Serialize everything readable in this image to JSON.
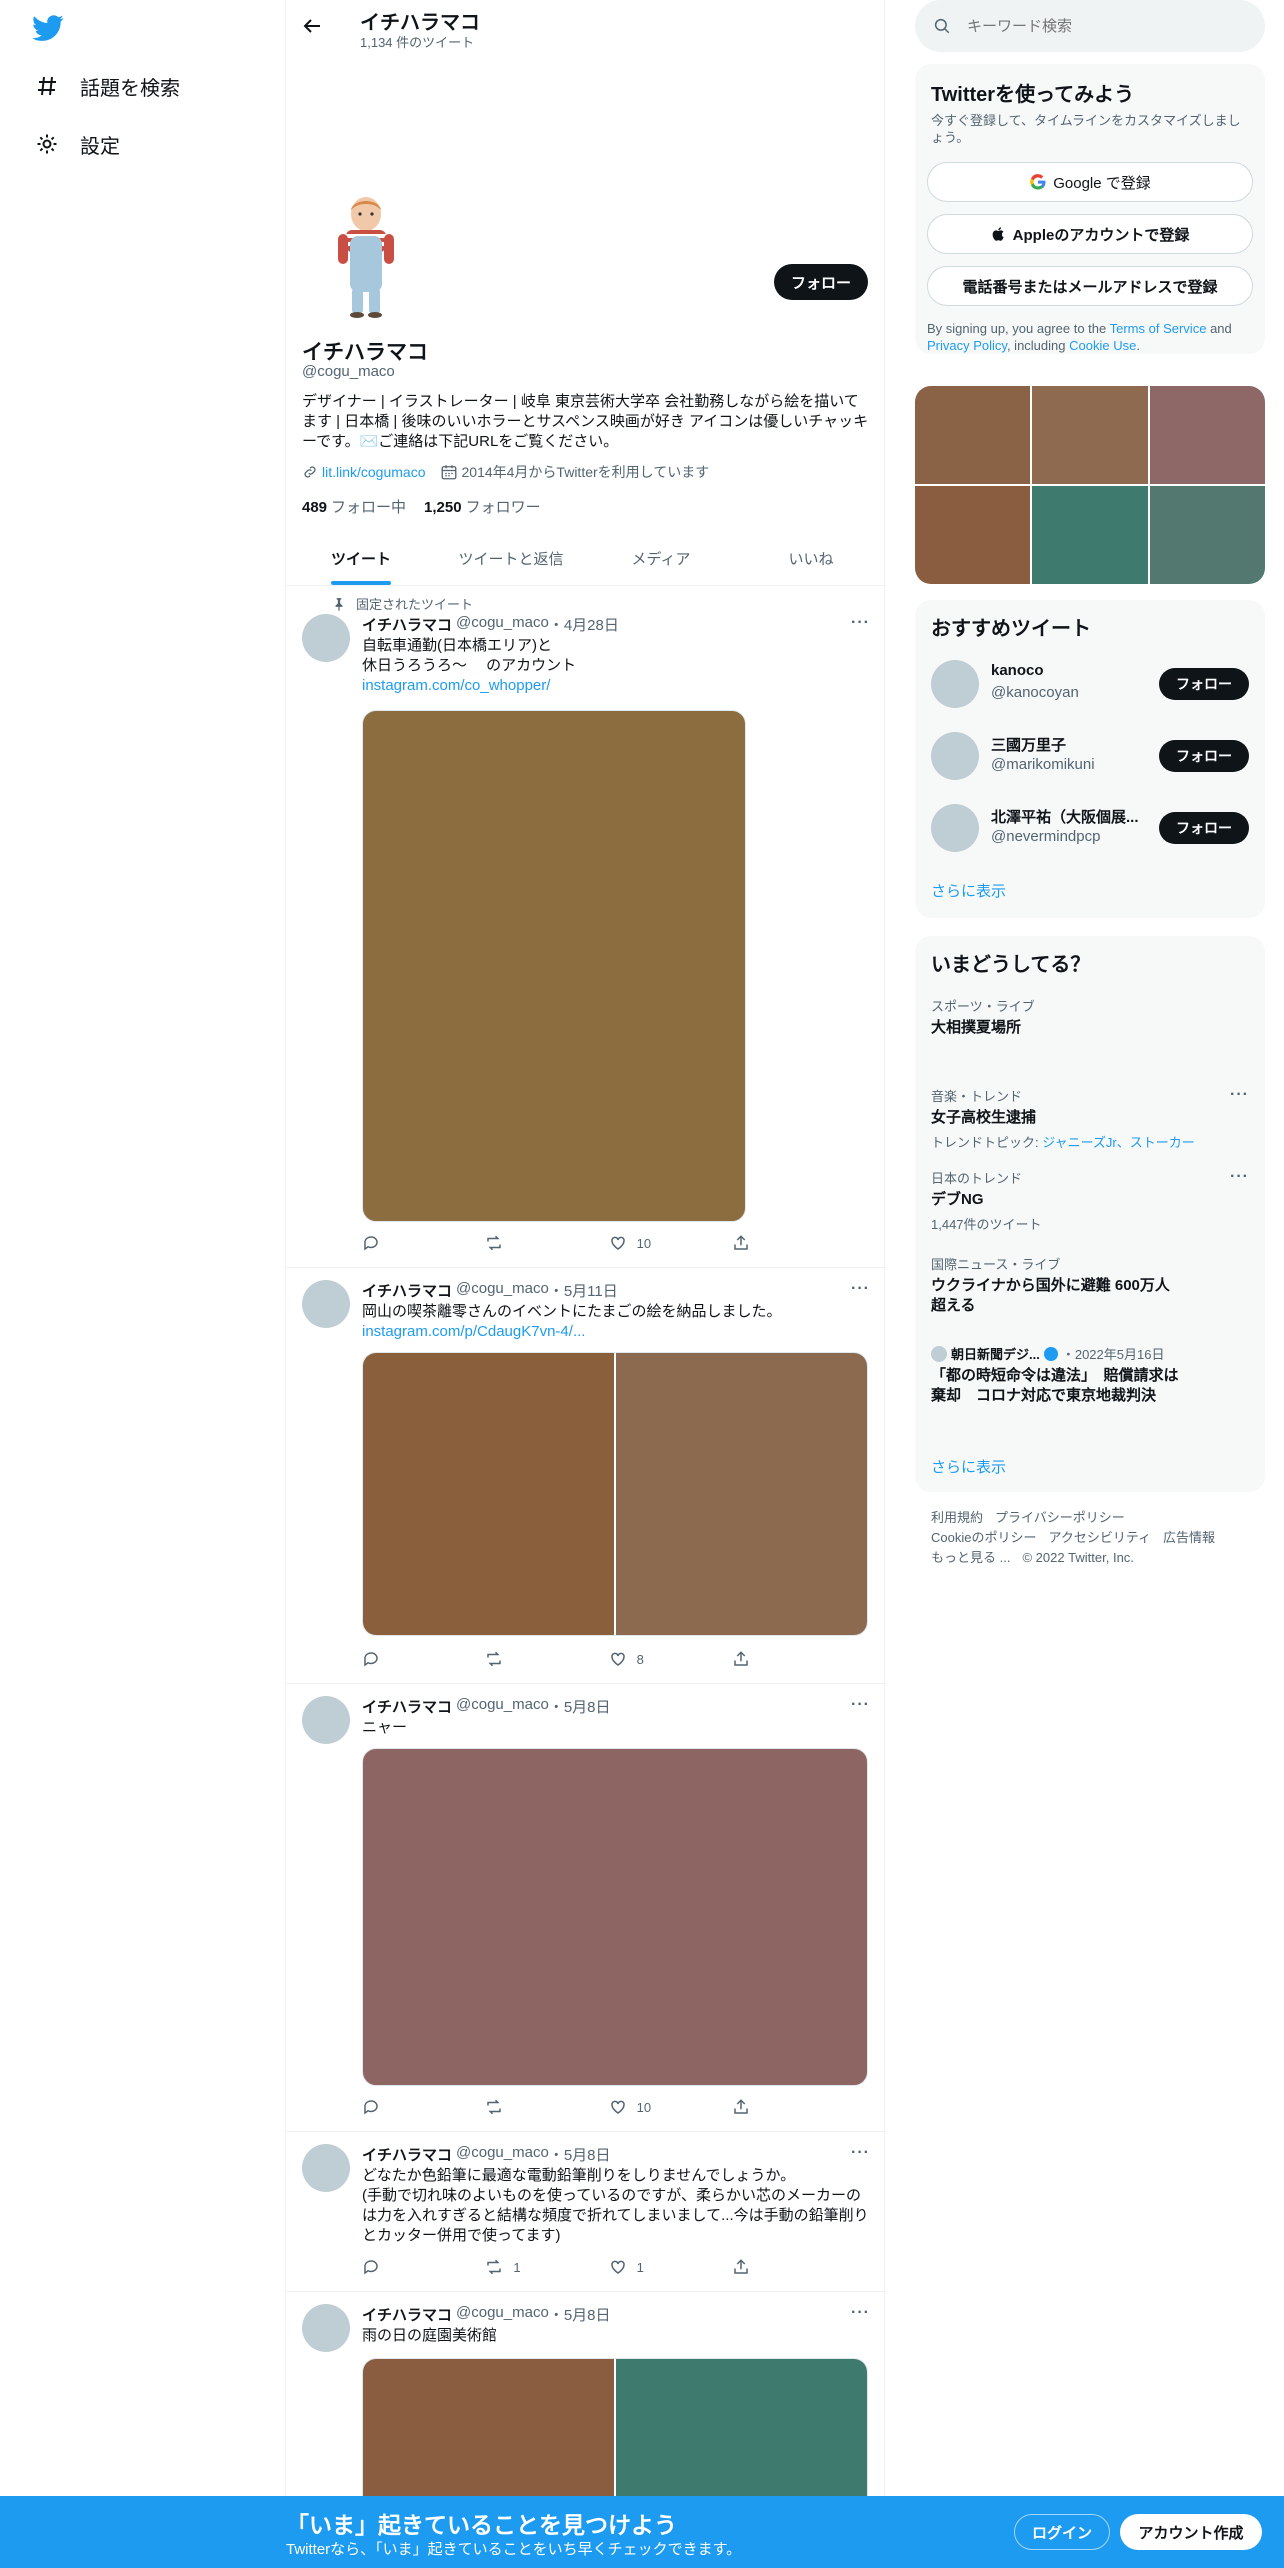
{
  "nav": {
    "explore_label": "話題を検索",
    "settings_label": "設定"
  },
  "header": {
    "title": "イチハラマコ",
    "tweet_count": "1,134 件のツイート"
  },
  "profile": {
    "name": "イチハラマコ",
    "handle": "@cogu_maco",
    "follow_label": "フォロー",
    "bio": "デザイナー | イラストレーター | 岐阜 東京芸術大学卒 会社勤務しながら絵を描いてます | 日本橋 | 後味のいいホラーとサスペンス映画が好き アイコンは優しいチャッキーです。✉️ご連絡は下記URLをご覧ください。",
    "link": "lit.link/cogumaco",
    "joined": "2014年4月からTwitterを利用しています",
    "following_count": "489",
    "following_label": "フォロー中",
    "followers_count": "1,250",
    "followers_label": "フォロワー"
  },
  "tabs": [
    "ツイート",
    "ツイートと返信",
    "メディア",
    "いいね"
  ],
  "pinned_label": "固定されたツイート",
  "tweets": [
    {
      "name": "イチハラマコ",
      "handle": "@cogu_maco",
      "date": "4月28日",
      "line1": "自転車通勤(日本橋エリア)と",
      "line2": "休日うろうろ〜　 のアカウント",
      "link": "instagram.com/co_whopper/",
      "likes": "10"
    },
    {
      "name": "イチハラマコ",
      "handle": "@cogu_maco",
      "date": "5月11日",
      "line1": "岡山の喫茶離零さんのイベントにたまごの絵を納品しました。",
      "link": "instagram.com/p/CdaugK7vn-4/...",
      "likes": "8"
    },
    {
      "name": "イチハラマコ",
      "handle": "@cogu_maco",
      "date": "5月8日",
      "line1": "ニャー",
      "likes": "10"
    },
    {
      "name": "イチハラマコ",
      "handle": "@cogu_maco",
      "date": "5月8日",
      "line1": "どなたか色鉛筆に最適な電動鉛筆削りをしりませんでしょうか。",
      "line2": "(手動で切れ味のよいものを使っているのですが、柔らかい芯のメーカーのは力を入れすぎると結構な頻度で折れてしまいまして...今は手動の鉛筆削りとカッター併用で使ってます)",
      "retweets": "1",
      "likes": "1"
    },
    {
      "name": "イチハラマコ",
      "handle": "@cogu_maco",
      "date": "5月8日",
      "line1": "雨の日の庭園美術館"
    }
  ],
  "search": {
    "placeholder": "キーワード検索"
  },
  "signup": {
    "title": "Twitterを使ってみよう",
    "desc": "今すぐ登録して、タイムラインをカスタマイズしましょう。",
    "google": "Google で登録",
    "apple": "Appleのアカウントで登録",
    "phone": "電話番号またはメールアドレスで登録",
    "terms_pre": "By signing up, you agree to the",
    "terms_link": "Terms of Service",
    "terms_and": "and",
    "privacy_link": "Privacy Policy",
    "terms_mid": ", including",
    "cookie_link": "Cookie Use",
    "terms_end": "."
  },
  "recs": {
    "title": "おすすめツイート",
    "follow_label": "フォロー",
    "items": [
      {
        "name": "kanoco",
        "handle": "@kanocoyan"
      },
      {
        "name": "三國万里子",
        "handle": "@marikomikuni"
      },
      {
        "name": "北澤平祐（大阪個展...",
        "handle": "@nevermindpcp"
      }
    ],
    "more": "さらに表示"
  },
  "trends": {
    "title": "いまどうしてる？",
    "items": [
      {
        "cat": "スポーツ・ライブ",
        "title": "大相撲夏場所"
      },
      {
        "cat": "音楽・トレンド",
        "title": "女子高校生逮捕",
        "sub_label": "トレンドトピック: ",
        "sub_link": "ジャニーズJr、ストーカー"
      },
      {
        "cat": "日本のトレンド",
        "title": "デブNG",
        "sub": "1,447件のツイート"
      },
      {
        "cat": "国際ニュース・ライブ",
        "title": "ウクライナから国外に避難 600万人超える"
      }
    ],
    "news": {
      "source": "朝日新聞デジ...",
      "date": "・2022年5月16日",
      "title": "「都の時短命令は違法」　賠償請求は棄却　コロナ対応で東京地裁判決"
    },
    "more": "さらに表示"
  },
  "footer": [
    "利用規約",
    "プライバシーポリシー",
    "Cookieのポリシー",
    "アクセシビリティ",
    "広告情報",
    "もっと見る ...",
    "© 2022 Twitter, Inc."
  ],
  "bottombar": {
    "title": "「いま」起きていることを見つけよう",
    "sub": "Twitterなら、「いま」起きていることをいち早くチェックできます。",
    "login": "ログイン",
    "signup": "アカウント作成"
  },
  "colors": {
    "accent": "#1d9bf0",
    "photo_grid": [
      "#8a6246",
      "#8e6a50",
      "#8e6866",
      "#8a5d40",
      "#3f7a6e",
      "#52786f"
    ]
  }
}
